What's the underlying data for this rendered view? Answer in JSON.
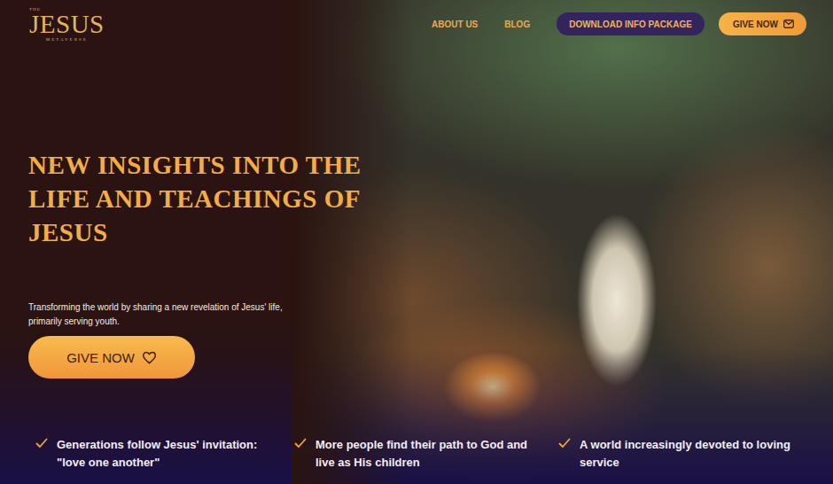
{
  "logo": {
    "top": "THE",
    "name": "JESUS",
    "bottom": "METAVERSE"
  },
  "nav": {
    "links": [
      "ABOUT US",
      "BLOG"
    ],
    "download": "DOWNLOAD INFO PACKAGE",
    "give": "GIVE NOW"
  },
  "hero": {
    "title": "NEW INSIGHTS INTO THE LIFE AND TEACHINGS OF JESUS",
    "subtitle": "Transforming the world by sharing a new revelation of Jesus' life, primarily serving youth.",
    "button": "GIVE NOW"
  },
  "features": [
    {
      "text": "Generations follow Jesus' invitation: \"love one another\""
    },
    {
      "text": "More people find their path to God and live as His children"
    },
    {
      "text": "A world increasingly devoted to loving service"
    }
  ]
}
